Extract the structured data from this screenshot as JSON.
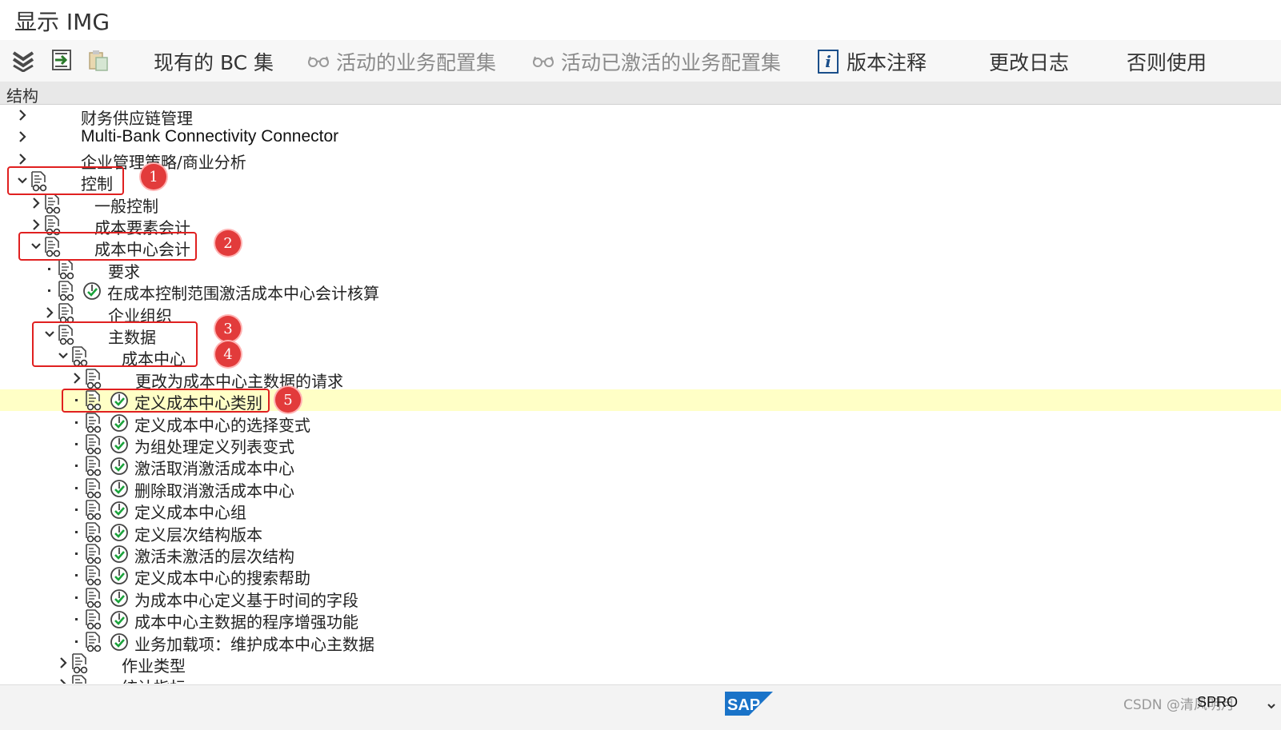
{
  "window": {
    "title": "显示 IMG"
  },
  "toolbar": {
    "icons": [
      "collapse-all-icon",
      "navigate-icon",
      "paste-icon"
    ],
    "buttons": [
      {
        "label": "现有的 BC 集",
        "enabled": true
      },
      {
        "label": "活动的业务配置集",
        "enabled": false,
        "icon": "glasses-icon"
      },
      {
        "label": "活动已激活的业务配置集",
        "enabled": false,
        "icon": "glasses-icon"
      },
      {
        "label": "版本注释",
        "enabled": true,
        "icon": "info-icon"
      },
      {
        "label": "更改日志",
        "enabled": true
      },
      {
        "label": "否则使用",
        "enabled": true
      }
    ]
  },
  "structure": {
    "header": "结构",
    "rows": [
      {
        "label": "财务供应链管理",
        "state": "collapsed",
        "doc": false,
        "activity": false
      },
      {
        "label": "Multi-Bank Connectivity Connector",
        "state": "collapsed",
        "doc": false,
        "activity": false
      },
      {
        "label": "企业管理策略/商业分析",
        "state": "collapsed",
        "doc": false,
        "activity": false
      },
      {
        "label": "控制",
        "state": "expanded",
        "doc": true,
        "activity": false
      },
      {
        "label": "一般控制",
        "state": "collapsed",
        "doc": true,
        "activity": false
      },
      {
        "label": "成本要素会计",
        "state": "collapsed",
        "doc": true,
        "activity": false
      },
      {
        "label": "成本中心会计",
        "state": "expanded",
        "doc": true,
        "activity": false
      },
      {
        "label": "要求",
        "state": "leaf",
        "doc": true,
        "activity": false
      },
      {
        "label": "在成本控制范围激活成本中心会计核算",
        "state": "leaf",
        "doc": true,
        "activity": true
      },
      {
        "label": "企业组织",
        "state": "collapsed",
        "doc": true,
        "activity": false
      },
      {
        "label": "主数据",
        "state": "expanded",
        "doc": true,
        "activity": false
      },
      {
        "label": "成本中心",
        "state": "expanded",
        "doc": true,
        "activity": false
      },
      {
        "label": "更改为成本中心主数据的请求",
        "state": "collapsed",
        "doc": true,
        "activity": false
      },
      {
        "label": "定义成本中心类别",
        "state": "leaf",
        "doc": true,
        "activity": true,
        "selected": true
      },
      {
        "label": "定义成本中心的选择变式",
        "state": "leaf",
        "doc": true,
        "activity": true
      },
      {
        "label": "为组处理定义列表变式",
        "state": "leaf",
        "doc": true,
        "activity": true
      },
      {
        "label": "激活取消激活成本中心",
        "state": "leaf",
        "doc": true,
        "activity": true
      },
      {
        "label": "删除取消激活成本中心",
        "state": "leaf",
        "doc": true,
        "activity": true
      },
      {
        "label": "定义成本中心组",
        "state": "leaf",
        "doc": true,
        "activity": true
      },
      {
        "label": "定义层次结构版本",
        "state": "leaf",
        "doc": true,
        "activity": true
      },
      {
        "label": "激活未激活的层次结构",
        "state": "leaf",
        "doc": true,
        "activity": true
      },
      {
        "label": "定义成本中心的搜索帮助",
        "state": "leaf",
        "doc": true,
        "activity": true
      },
      {
        "label": "为成本中心定义基于时间的字段",
        "state": "leaf",
        "doc": true,
        "activity": true
      },
      {
        "label": "成本中心主数据的程序增强功能",
        "state": "leaf",
        "doc": true,
        "activity": true
      },
      {
        "label": "业务加载项：维护成本中心主数据",
        "state": "leaf",
        "doc": true,
        "activity": true
      },
      {
        "label": "作业类型",
        "state": "collapsed",
        "doc": true,
        "activity": false
      },
      {
        "label": "统计指标",
        "state": "collapsed",
        "doc": true,
        "activity": false
      }
    ]
  },
  "annotations": {
    "markers": [
      "1",
      "2",
      "3",
      "4",
      "5"
    ]
  },
  "footer": {
    "watermark": "CSDN @清风明月",
    "tcode": "SPRO"
  },
  "colors": {
    "selected_row": "#ffffc6",
    "annotation_red": "#e02020",
    "sap_blue": "#1a73c8"
  }
}
